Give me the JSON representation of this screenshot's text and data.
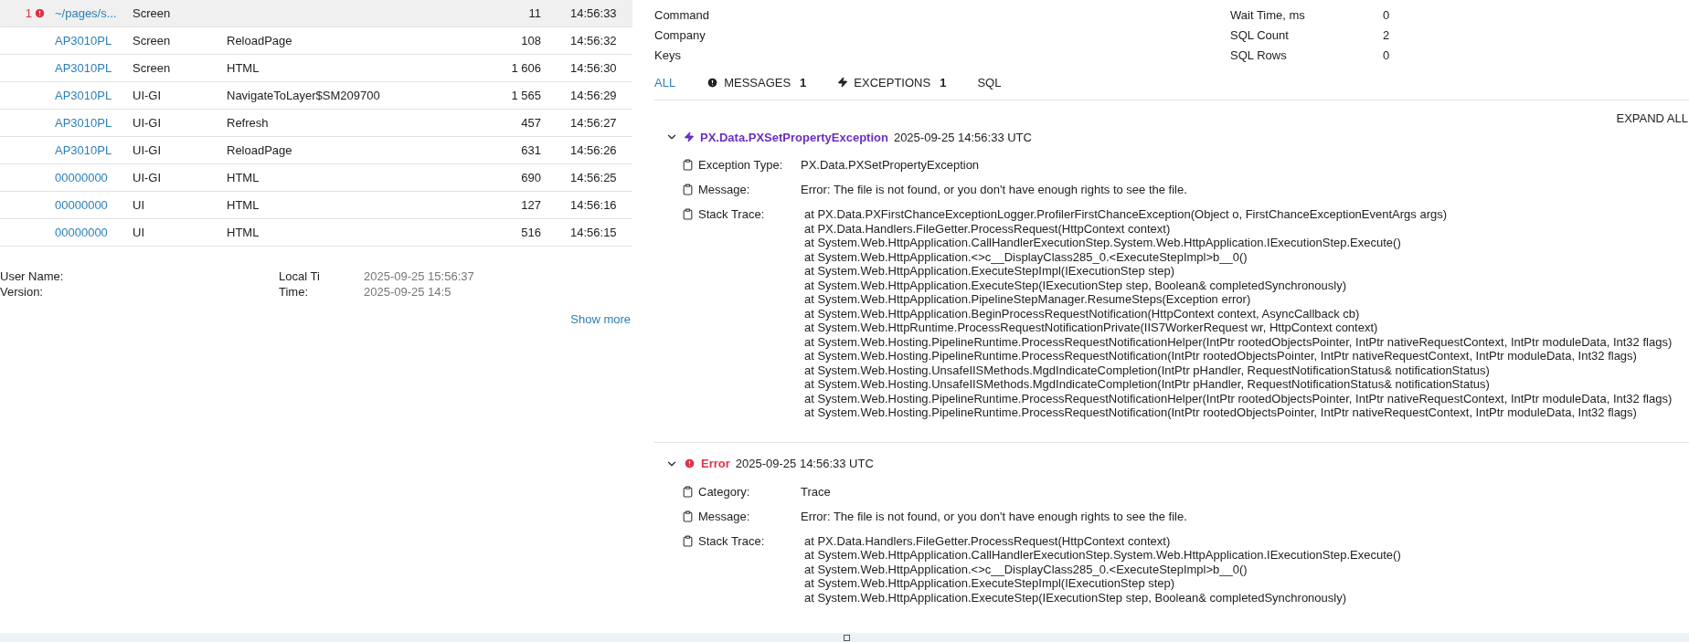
{
  "requests": [
    {
      "badge": "1",
      "screen": "~/pages/s...",
      "type": "Screen",
      "count": "11",
      "time": "14:56:33",
      "selected": true
    },
    {
      "screen": "AP3010PL",
      "type": "Screen",
      "action": "ReloadPage",
      "count": "108",
      "time": "14:56:32",
      "selected": false
    },
    {
      "screen": "AP3010PL",
      "type": "Screen",
      "action": "HTML",
      "count": "1 606",
      "time": "14:56:30",
      "selected": false
    },
    {
      "screen": "AP3010PL",
      "type": "UI-GI",
      "action": "NavigateToLayer$SM209700",
      "count": "1 565",
      "time": "14:56:29",
      "selected": false
    },
    {
      "screen": "AP3010PL",
      "type": "UI-GI",
      "action": "Refresh",
      "count": "457",
      "time": "14:56:27",
      "selected": false
    },
    {
      "screen": "AP3010PL",
      "type": "UI-GI",
      "action": "ReloadPage",
      "count": "631",
      "time": "14:56:26",
      "selected": false
    },
    {
      "screen": "00000000",
      "type": "UI-GI",
      "action": "HTML",
      "count": "690",
      "time": "14:56:25",
      "selected": false
    },
    {
      "screen": "00000000",
      "type": "UI",
      "action": "HTML",
      "count": "127",
      "time": "14:56:16",
      "selected": false
    },
    {
      "screen": "00000000",
      "type": "UI",
      "action": "HTML",
      "count": "516",
      "time": "14:56:15",
      "selected": false
    }
  ],
  "environment": {
    "left": [
      {
        "label": "User Name:"
      },
      {
        "label": "Version:"
      }
    ],
    "right": [
      {
        "label": "Local Ti",
        "value": "2025-09-25 15:56:37"
      },
      {
        "label": "Time:",
        "value": "2025-09-25 14:5"
      }
    ],
    "show_more": "Show more"
  },
  "details": {
    "left": [
      {
        "label": "Command"
      },
      {
        "label": "Company"
      },
      {
        "label": "Keys"
      }
    ],
    "right": [
      {
        "label": "Wait Time, ms",
        "value": "0"
      },
      {
        "label": "SQL Count",
        "value": "2"
      },
      {
        "label": "SQL Rows",
        "value": "0"
      }
    ]
  },
  "tabs": [
    {
      "kind": "plain",
      "label": "ALL",
      "selected": true
    },
    {
      "kind": "messages",
      "label": "MESSAGES",
      "count": "1",
      "selected": false
    },
    {
      "kind": "exceptions",
      "label": "EXCEPTIONS",
      "count": "1",
      "selected": false
    },
    {
      "kind": "plain",
      "label": "SQL",
      "selected": false
    }
  ],
  "expand_all": "EXPAND ALL",
  "events": [
    {
      "kind": "exception",
      "title": "PX.Data.PXSetPropertyException",
      "timestamp": "2025-09-25 14:56:33 UTC",
      "expanded": true,
      "fields": [
        {
          "label": "Exception Type:",
          "value": "PX.Data.PXSetPropertyException"
        },
        {
          "label": "Message:",
          "value": "Error: The file is not found, or you don't have enough rights to see the file."
        }
      ],
      "stack_label": "Stack Trace:",
      "stack": [
        "at PX.Data.PXFirstChanceExceptionLogger.ProfilerFirstChanceException(Object o, FirstChanceExceptionEventArgs args)",
        "at PX.Data.Handlers.FileGetter.ProcessRequest(HttpContext context)",
        "at System.Web.HttpApplication.CallHandlerExecutionStep.System.Web.HttpApplication.IExecutionStep.Execute()",
        "at System.Web.HttpApplication.<>c__DisplayClass285_0.<ExecuteStepImpl>b__0()",
        "at System.Web.HttpApplication.ExecuteStepImpl(IExecutionStep step)",
        "at System.Web.HttpApplication.ExecuteStep(IExecutionStep step, Boolean& completedSynchronously)",
        "at System.Web.HttpApplication.PipelineStepManager.ResumeSteps(Exception error)",
        "at System.Web.HttpApplication.BeginProcessRequestNotification(HttpContext context, AsyncCallback cb)",
        "at System.Web.HttpRuntime.ProcessRequestNotificationPrivate(IIS7WorkerRequest wr, HttpContext context)",
        "at System.Web.Hosting.PipelineRuntime.ProcessRequestNotificationHelper(IntPtr rootedObjectsPointer, IntPtr nativeRequestContext, IntPtr moduleData, Int32 flags)",
        "at System.Web.Hosting.PipelineRuntime.ProcessRequestNotification(IntPtr rootedObjectsPointer, IntPtr nativeRequestContext, IntPtr moduleData, Int32 flags)",
        "at System.Web.Hosting.UnsafeIISMethods.MgdIndicateCompletion(IntPtr pHandler, RequestNotificationStatus& notificationStatus)",
        "at System.Web.Hosting.UnsafeIISMethods.MgdIndicateCompletion(IntPtr pHandler, RequestNotificationStatus& notificationStatus)",
        "at System.Web.Hosting.PipelineRuntime.ProcessRequestNotificationHelper(IntPtr rootedObjectsPointer, IntPtr nativeRequestContext, IntPtr moduleData, Int32 flags)",
        "at System.Web.Hosting.PipelineRuntime.ProcessRequestNotification(IntPtr rootedObjectsPointer, IntPtr nativeRequestContext, IntPtr moduleData, Int32 flags)"
      ]
    },
    {
      "kind": "error",
      "title": "Error",
      "timestamp": "2025-09-25 14:56:33 UTC",
      "expanded": true,
      "fields": [
        {
          "label": "Category:",
          "value": "Trace"
        },
        {
          "label": "Message:",
          "value": "Error: The file is not found, or you don't have enough rights to see the file."
        }
      ],
      "stack_label": "Stack Trace:",
      "stack": [
        "at PX.Data.Handlers.FileGetter.ProcessRequest(HttpContext context)",
        "at System.Web.HttpApplication.CallHandlerExecutionStep.System.Web.HttpApplication.IExecutionStep.Execute()",
        "at System.Web.HttpApplication.<>c__DisplayClass285_0.<ExecuteStepImpl>b__0()",
        "at System.Web.HttpApplication.ExecuteStepImpl(IExecutionStep step)",
        "at System.Web.HttpApplication.ExecuteStep(IExecutionStep step, Boolean& completedSynchronously)"
      ]
    }
  ]
}
